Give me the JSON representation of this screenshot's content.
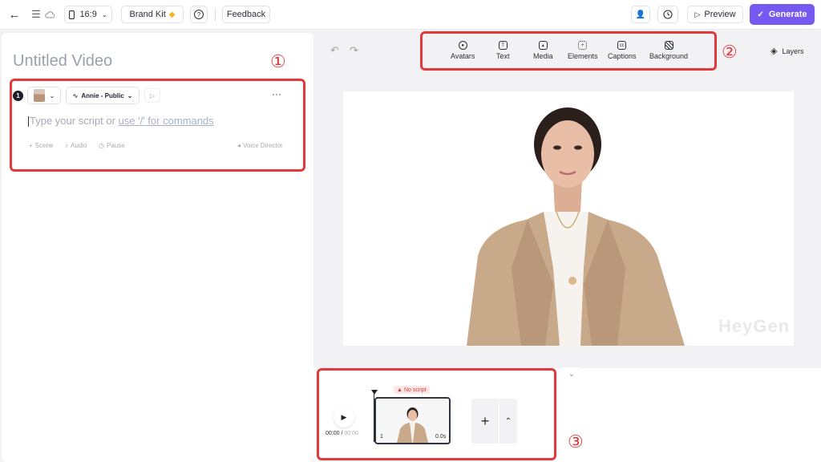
{
  "topbar": {
    "aspect_ratio": "16:9",
    "brand_kit_label": "Brand Kit",
    "feedback_label": "Feedback",
    "preview_label": "Preview",
    "generate_label": "Generate",
    "accent_color": "#7559f1"
  },
  "left_panel": {
    "title": "Untitled Video",
    "scene": {
      "number": "1",
      "voice_name": "Annie - Public",
      "script_placeholder_prefix": "Type your script or ",
      "script_placeholder_link": "use '/' for commands",
      "actions": [
        "Scene",
        "Audio",
        "Pause"
      ],
      "voice_director_label": "Voice Director"
    }
  },
  "toolbar": {
    "items": [
      {
        "label": "Avatars",
        "icon": "avatar-icon"
      },
      {
        "label": "Text",
        "icon": "text-icon"
      },
      {
        "label": "Media",
        "icon": "image-icon"
      },
      {
        "label": "Elements",
        "icon": "elements-icon"
      },
      {
        "label": "Captions",
        "icon": "captions-icon"
      },
      {
        "label": "Background",
        "icon": "background-icon"
      }
    ],
    "layers_label": "Layers"
  },
  "canvas": {
    "watermark": "HeyGen"
  },
  "timeline": {
    "current_time": "00:00",
    "total_time": "00:00",
    "warning": "No script",
    "clip_index": "1",
    "clip_duration": "0.0s"
  },
  "annotations": {
    "marker_1": "①",
    "marker_2": "②",
    "marker_3": "③",
    "highlight_color": "#e23a3a"
  }
}
